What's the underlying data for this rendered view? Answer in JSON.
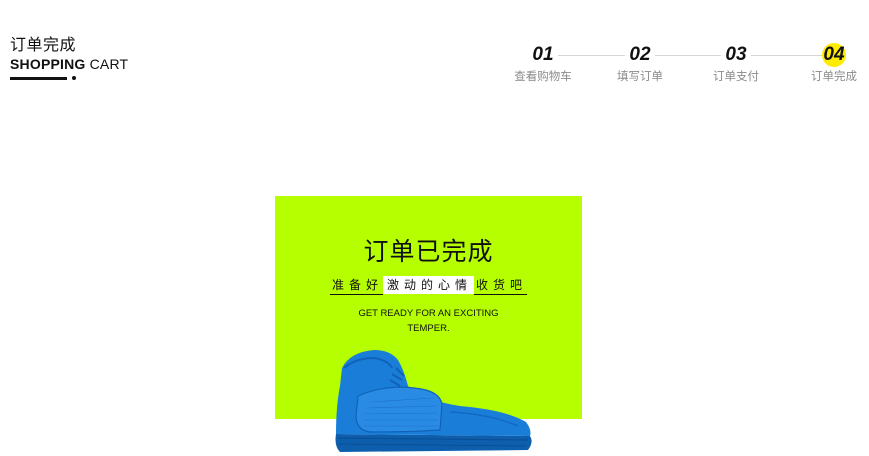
{
  "brand": {
    "title_cn": "订单完成",
    "title_en_bold": "SHOPPING",
    "title_en_thin": " CART"
  },
  "steps": [
    {
      "number": "01",
      "label": "查看购物车",
      "active": false
    },
    {
      "number": "02",
      "label": "填写订单",
      "active": false
    },
    {
      "number": "03",
      "label": "订单支付",
      "active": false
    },
    {
      "number": "04",
      "label": "订单完成",
      "active": true
    }
  ],
  "card": {
    "title": "订单已完成",
    "subtitle_part1": "准备好",
    "subtitle_part2": "激动的心情",
    "subtitle_part3": "收货吧",
    "english_line1": "GET READY FOR AN EXCITING",
    "english_line2": "TEMPER."
  },
  "colors": {
    "card_background": "#b6ff00",
    "active_step": "#ffec00",
    "shoe": "#1a7ed9",
    "text": "#111111"
  },
  "icons": {
    "shoe": "sneaker-image"
  }
}
